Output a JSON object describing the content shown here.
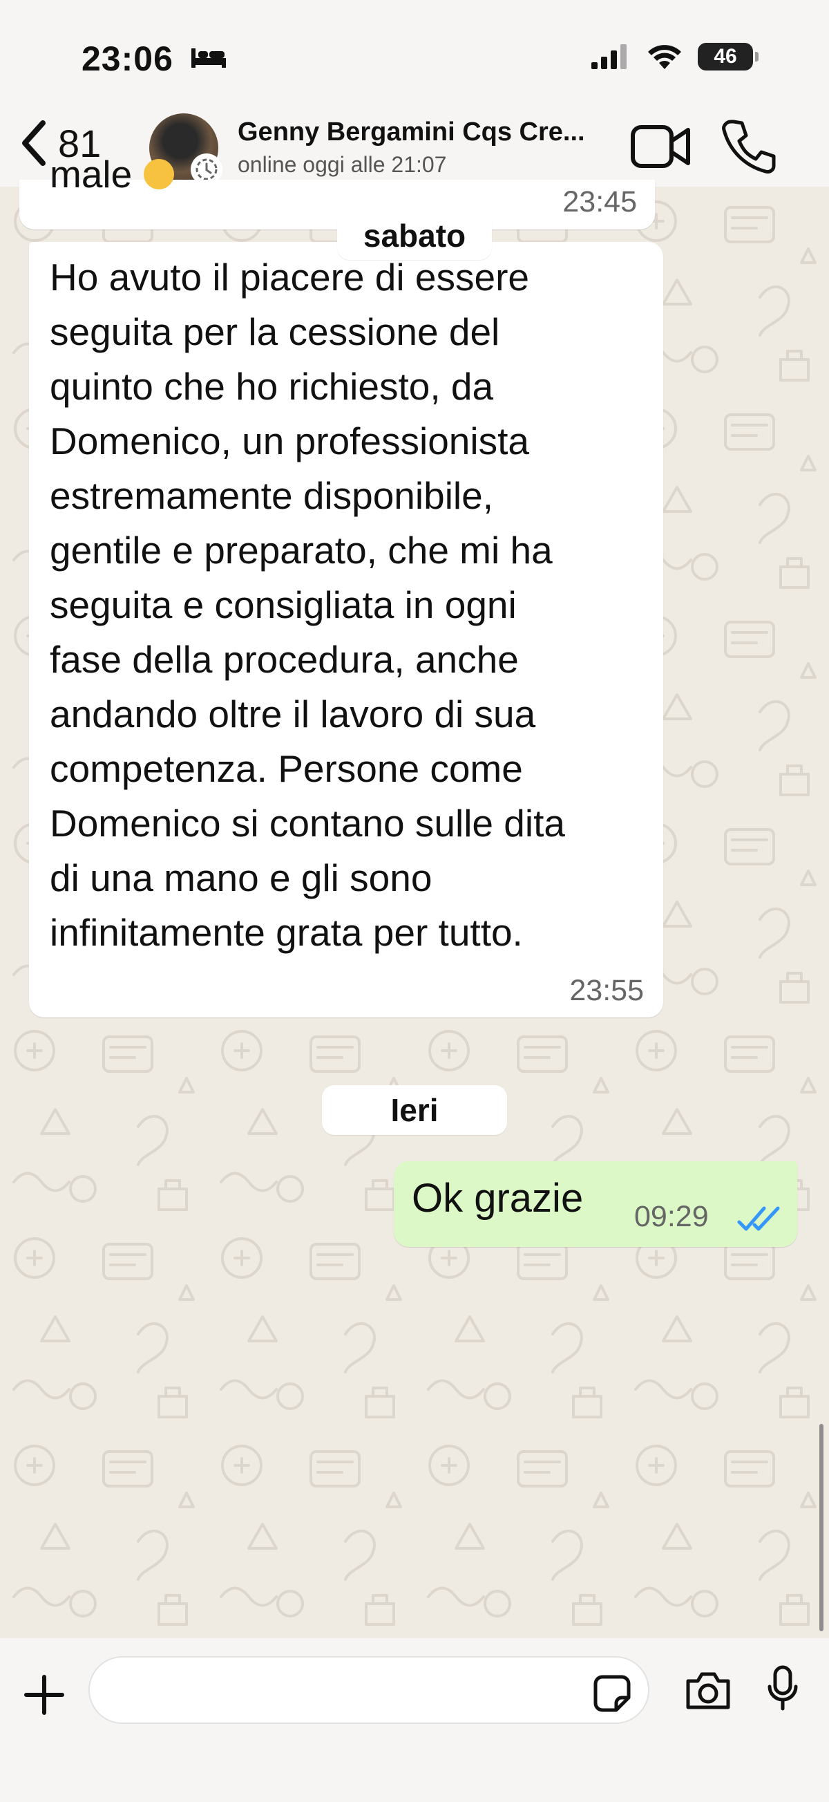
{
  "status_bar": {
    "time": "23:06",
    "battery": "46"
  },
  "header": {
    "back_count": "81",
    "contact_name": "Genny Bergamini Cqs Cre...",
    "contact_status": "online oggi alle 21:07"
  },
  "messages": {
    "prev_text": "male",
    "prev_time": "23:45",
    "date_separator_1": "sabato",
    "review_lines": [
      "Ho avuto il piacere di essere",
      "seguita per la cessione del",
      "quinto che ho richiesto, da",
      "Domenico, un professionista",
      "estremamente disponibile,",
      "gentile e preparato, che mi ha",
      "seguita e consigliata in ogni",
      "fase della procedura, anche",
      "andando oltre il lavoro di sua",
      "competenza. Persone come",
      "Domenico si contano sulle dita",
      "di una mano e gli sono",
      "infinitamente grata per tutto."
    ],
    "review_time": "23:55",
    "date_separator_2": "Ieri",
    "outgoing_text": "Ok grazie",
    "outgoing_time": "09:29"
  },
  "composer": {
    "placeholder": ""
  },
  "colors": {
    "outgoing_bubble": "#dcf8c6",
    "read_ticks": "#3497f9",
    "wallpaper": "#efeae2"
  },
  "icons": [
    "bed-icon",
    "signal-icon",
    "wifi-icon",
    "battery-icon",
    "back-chevron-icon",
    "status-ring-icon",
    "video-call-icon",
    "phone-icon",
    "plus-icon",
    "sticker-icon",
    "camera-icon",
    "microphone-icon",
    "read-ticks-icon",
    "emoji-icon"
  ]
}
